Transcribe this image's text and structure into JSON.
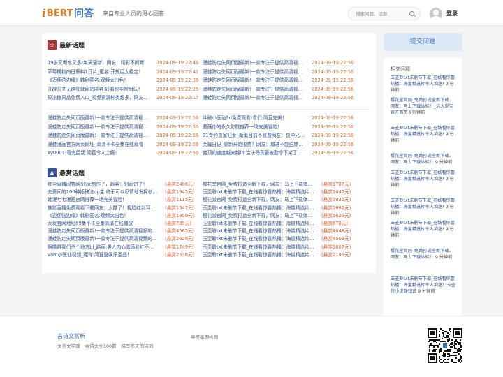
{
  "header": {
    "logo_mark": "i",
    "logo_bert": "BERT",
    "logo_cn": "问答",
    "tagline": "来自专业人员的用心回答",
    "search_placeholder": "搜索问题、话题",
    "login": "登录"
  },
  "latest": {
    "title": "最新话题",
    "icon": "chinese-knot-icon",
    "group1": {
      "left": [
        {
          "title": "19岁又断水又多!每天更新，网友：精彩不间断",
          "date": "2024-09-19 22:46"
        },
        {
          "title": "草莓樱桃向日葵料1汀片_匿名:开放后太稳定！",
          "date": "2024-09-19 22:41"
        },
        {
          "title": "《迈佣弦边缘》韩剧匿名:观频太出色！",
          "date": "2024-09-19 22:36"
        },
        {
          "title": "开辟开艾无辟狂就网站匿名:好看也非常耐玩！",
          "date": "2024-09-19 22:25"
        },
        {
          "title": "果冻糖果晶免费入口_视频资源种类超多，网友…",
          "date": "2024-09-19 22:17"
        }
      ],
      "right": [
        {
          "title": "漫蛙防走失网页版最新!一款专注于提供高清视…",
          "date": "2024-09-19 22:56"
        },
        {
          "title": "漫蛙防走失网页版最新!一款专注于提供高清视…",
          "date": "2024-09-19 22:56"
        },
        {
          "title": "漫蛙防走失网页版最新!一款专注于提供高清视…",
          "date": "2024-09-19 22:56"
        },
        {
          "title": "漫蛙防走失网页版最新!一款专注于提供高清视…",
          "date": "2024-09-19 22:56"
        },
        {
          "title": "漫蛙防走失网页版最新!一款专注于提供高清视…",
          "date": "2024-09-19 22:56"
        }
      ]
    },
    "group2": {
      "left": [
        {
          "title": "漫蛙防走失网页版最新!一款专注于提供高清视…",
          "date": "2024-09-19 22:56"
        },
        {
          "title": "漫蛙防走失网页版最新!一款专注于提供高清视…",
          "date": "2024-09-19 22:56"
        },
        {
          "title": "漫蛙防走失网页版最新!一款专注于提供高清视…",
          "date": "2024-09-19 22:56"
        },
        {
          "title": "漫蛙漫画官方网页网址_高清不卡全集在线观看",
          "date": "2024-09-19 22:56"
        },
        {
          "title": "xy0001:看完后我:简直令人上瘾！",
          "date": "2024-09-19 22:56"
        }
      ],
      "right": [
        {
          "title": "斗破小医仙3d免费观看!看们:简直完美！",
          "date": "2024-09-19 22:56"
        },
        {
          "title": "蘑菇你的永久影院推荐一场完美冒险！",
          "date": "2024-09-19 22:56"
        },
        {
          "title": "91专约良家妇女_新诞目前不收费网友：快冲兄…",
          "date": "2024-09-19 22:56"
        },
        {
          "title": "芙骗日记_重新开始收费？网友：增进不能白嫖…",
          "date": "2024-09-19 22:56"
        },
        {
          "title": "他顶的速度越来越lh:连法码真要被勤令下架了…",
          "date": "2024-09-19 22:56"
        }
      ]
    }
  },
  "bounty": {
    "title": "悬赏话题",
    "icon": "mountain-icon",
    "left": [
      {
        "title": "红尘直播间官网!出大制作了，跟客：别画饼了！",
        "reward": "(悬赏2406元)"
      },
      {
        "title": "夫妻间的100种插秧法up主:终于可以尽情地发挥创…",
        "reward": "(悬赏1945元)"
      },
      {
        "title": "韩漫七七漫画官网推荐一场完美冒险！",
        "reward": "(悬赏1115元)"
      },
      {
        "title": "魅影直播免费观看下载网友：太酷了！我脸红到耳…",
        "reward": "(悬赏1347元)"
      },
      {
        "title": "《迈佣弦边缘》韩剧匿名:观频太出色！",
        "reward": "(悬赏1859元)"
      },
      {
        "title": "大发官网地址89集不卡全集高清在线播放",
        "reward": "(悬赏789元)"
      },
      {
        "title": "漫蛙防走失网页版最新!一款专注于提供高清视频的…",
        "reward": "(悬赏4565元)"
      },
      {
        "title": "漫蛙防走失网页版最新!一款专注于提供高清视频的…",
        "reward": "(悬赏2636元)"
      },
      {
        "title": "啊撒跳我们杀个地方bl_路丽:男人内心激荡脸红不…",
        "reward": "(悬赏1749元)"
      },
      {
        "title": "vam小医仙视频_昵称:简直是娱乐圣品！",
        "reward": "(悬赏2536元)"
      }
    ],
    "right": [
      {
        "title": "樱花堂官网_免费打造全新下载，网友：马上下载体…",
        "reward": "(悬赏1787元)"
      },
      {
        "title": "玉壶聆txt未删节下载_在线看惊喜热播：海量精选片…",
        "reward": "(悬赏1442元)"
      },
      {
        "title": "樱花堂官网_免费打造全新下载，网友：马上下载体…",
        "reward": "(悬赏3932元)"
      },
      {
        "title": "玉壶聆txt未删节下载_在线看惊喜热播：海量精选片…",
        "reward": "(悬赏1882元)"
      },
      {
        "title": "樱花堂官网_免费打造全新下载，网友：马上下载体…",
        "reward": "(悬赏1629元)"
      },
      {
        "title": "玉壶聆txt未删节下载_在线看惊喜热播：海量精选片…",
        "reward": "(悬赏678元)"
      },
      {
        "title": "玉壶聆txt未删节下载_在线看惊喜热播：海量精选片…",
        "reward": "(悬赏4648元)"
      },
      {
        "title": "玉壶聆txt未删节下载_在线看惊喜热播：海量精选片…",
        "reward": "(悬赏4503元)"
      },
      {
        "title": "玉壶聆txt未删节下载_在线看惊喜热播：海量精选片…",
        "reward": "(悬赏3607元)"
      },
      {
        "title": "玉壶聆txt未删节下载_在线看惊喜热播：海量精选片…",
        "reward": "(悬赏2149元)"
      }
    ]
  },
  "sidebar": {
    "ask_button": "提交问题",
    "related_title": "相关问题",
    "related": [
      {
        "text": "玉壶聆txt未删节下载_在线看惊喜热播：海量精选片令人痴迷!",
        "meta": " 9 分钟前"
      },
      {
        "text": "樱花堂官网_免费打造全新下载，网友：马上下载体验！_话大说宝官方首页",
        "meta": " 9分钟前"
      },
      {
        "text": "玉壶聆txt未删节下载_在线看惊喜热播：海量精选片令人痴迷!",
        "meta": " 9 分钟前"
      },
      {
        "text": "樱花堂官网_免费打造全新下载，网友：马上下载体验！",
        "meta": " 9 分钟前"
      },
      {
        "text": "玉壶聆txt未删节下载_在线看惊喜热播：海量精选片令人痴迷!",
        "meta": " 9 分钟前"
      },
      {
        "text": "玉壶聆txt未删节下载_在线看惊喜热播：海量精选片令人痴迷!",
        "meta": " 9 分钟前"
      },
      {
        "text": "玉壶聆txt未删节下载_在线看惊喜热播：海量精选片令人痴迷!",
        "meta": " 9 分钟前"
      },
      {
        "text": "樱花堂官网_免费打造全新下载，网友：马上下载体验！",
        "meta": " 9 分钟前"
      },
      {
        "text": "玉壶聆txt未删节下载_在线看惊喜热播：海量精选片令人痴迷！玉壶传小说静归说",
        "meta": " 9 分钟前"
      }
    ]
  },
  "footer": {
    "title": "古诗文赏析",
    "links": [
      "文言文学观",
      "古诗大全300首",
      "描写冬天的诗词"
    ],
    "middle": "癌症基因检测",
    "qr_icon": "qr-code-icon"
  }
}
